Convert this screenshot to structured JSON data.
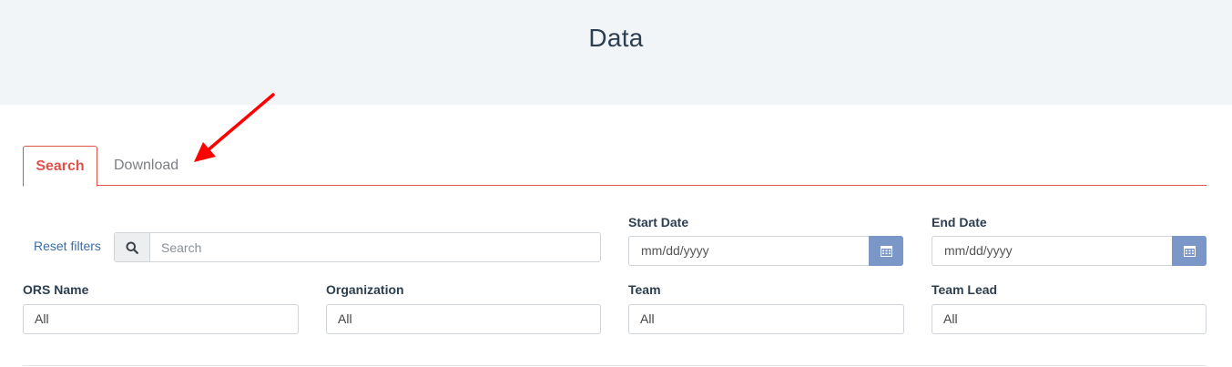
{
  "header": {
    "title": "Data"
  },
  "tabs": [
    {
      "label": "Search",
      "active": true
    },
    {
      "label": "Download",
      "active": false
    }
  ],
  "filters": {
    "reset_label": "Reset filters",
    "search_placeholder": "Search",
    "start_date": {
      "label": "Start Date",
      "value": "mm/dd/yyyy"
    },
    "end_date": {
      "label": "End Date",
      "value": "mm/dd/yyyy"
    },
    "ors_name": {
      "label": "ORS Name",
      "value": "All"
    },
    "organization": {
      "label": "Organization",
      "value": "All"
    },
    "team": {
      "label": "Team",
      "value": "All"
    },
    "team_lead": {
      "label": "Team Lead",
      "value": "All"
    }
  },
  "colors": {
    "accent": "#e0534a",
    "link": "#3a6ea5",
    "calendar_button": "#7b97c8",
    "header_bg": "#f2f5f7",
    "annotation_arrow": "#ff0000"
  },
  "icons": [
    "search-icon",
    "calendar-icon",
    "annotation-arrow"
  ]
}
